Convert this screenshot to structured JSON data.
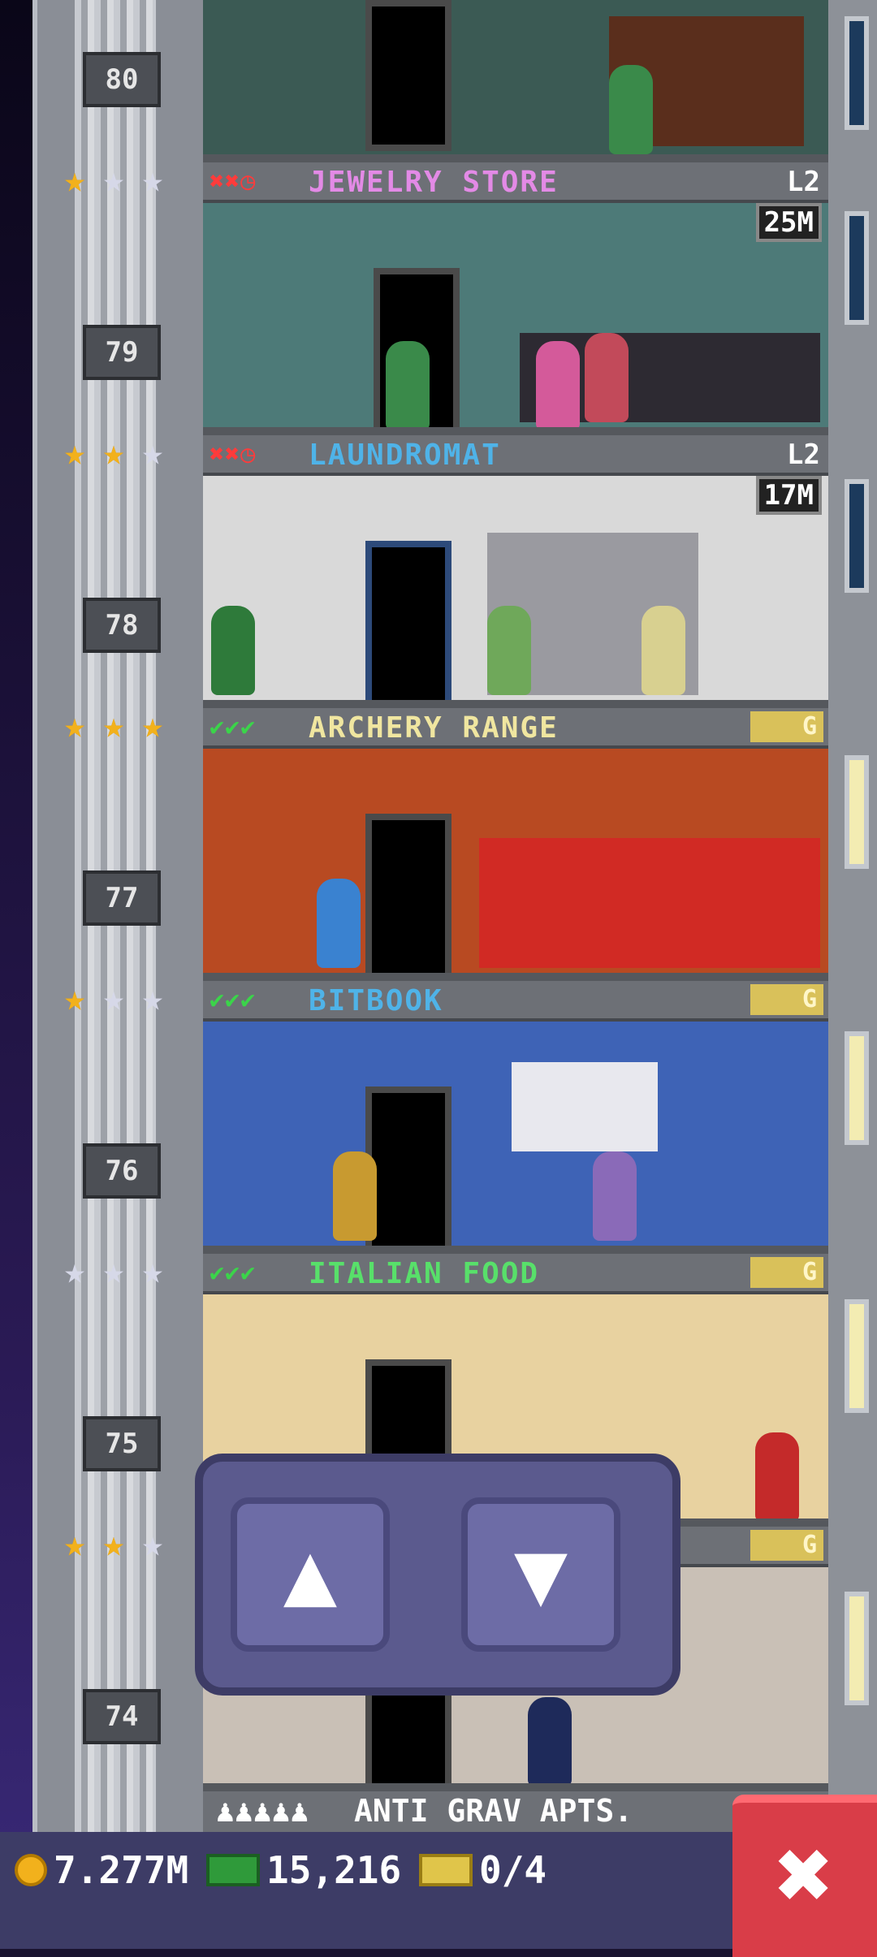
{
  "floor_numbers": [
    "80",
    "79",
    "78",
    "77",
    "76",
    "75",
    "74"
  ],
  "floors": [
    {
      "name": "JEWELRY STORE",
      "color": "#e38ae6",
      "status": "✖✖◷",
      "status_color": "#ff3b3b",
      "level": "L2",
      "time": "25M",
      "badge": "",
      "stars": [
        "gold",
        "silver",
        "silver"
      ]
    },
    {
      "name": "LAUNDROMAT",
      "color": "#4fb3e8",
      "status": "✖✖◷",
      "status_color": "#ff3b3b",
      "level": "L2",
      "time": "17M",
      "badge": "",
      "stars": [
        "gold",
        "gold",
        "silver"
      ]
    },
    {
      "name": "ARCHERY RANGE",
      "color": "#f0e6a0",
      "status": "✔✔✔",
      "status_color": "#3bd44a",
      "level": "",
      "time": "",
      "badge": "G",
      "stars": [
        "gold",
        "gold",
        "gold"
      ]
    },
    {
      "name": "BITBOOK",
      "color": "#4fb3e8",
      "status": "✔✔✔",
      "status_color": "#3bd44a",
      "level": "",
      "time": "",
      "badge": "G",
      "stars": [
        "gold",
        "silver",
        "silver"
      ]
    },
    {
      "name": "ITALIAN FOOD",
      "color": "#58e06a",
      "status": "✔✔✔",
      "status_color": "#3bd44a",
      "level": "",
      "time": "",
      "badge": "G",
      "stars": [
        "silver",
        "silver",
        "silver"
      ]
    }
  ],
  "floor74": {
    "badge": "G",
    "stars": [
      "gold",
      "gold",
      "silver"
    ]
  },
  "anti_grav": {
    "label": "ANTI GRAV APTS.",
    "residents": "♟♟♟♟♟"
  },
  "controls": {
    "up": "▲",
    "down": "▼"
  },
  "bottom_bar": {
    "coins": "7.277M",
    "bux": "15,216",
    "tickets": "0/4"
  },
  "close_label": "✖",
  "icons": {
    "coin": "coin-icon",
    "cash": "tower-bux-icon",
    "ticket": "golden-ticket-icon"
  }
}
